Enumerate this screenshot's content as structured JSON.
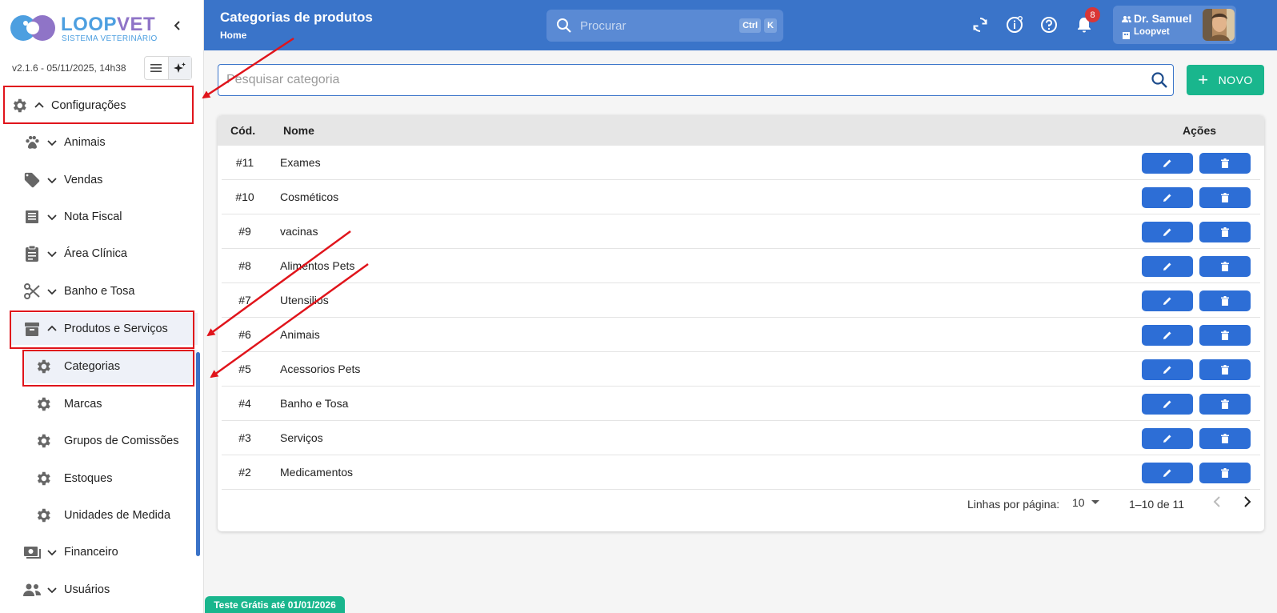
{
  "brand": {
    "name_part1": "LOOP",
    "name_part2": "VET",
    "subtitle": "SISTEMA VETERINÁRIO",
    "version": "v2.1.6 - 05/11/2025, 14h38"
  },
  "sidebar": {
    "items": [
      {
        "label": "Configurações",
        "icon": "gear-icon",
        "expanded": true
      },
      {
        "label": "Animais",
        "icon": "paw-icon"
      },
      {
        "label": "Vendas",
        "icon": "tag-icon"
      },
      {
        "label": "Nota Fiscal",
        "icon": "receipt-icon"
      },
      {
        "label": "Área Clínica",
        "icon": "clipboard-icon"
      },
      {
        "label": "Banho e Tosa",
        "icon": "scissors-icon"
      },
      {
        "label": "Produtos e Serviços",
        "icon": "archive-icon",
        "expanded": true
      },
      {
        "label": "Financeiro",
        "icon": "money-icon"
      },
      {
        "label": "Usuários",
        "icon": "users-icon"
      }
    ],
    "sub_items": [
      {
        "label": "Categorias",
        "icon": "gear-icon",
        "active": true
      },
      {
        "label": "Marcas",
        "icon": "gear-icon"
      },
      {
        "label": "Grupos de Comissões",
        "icon": "gear-icon"
      },
      {
        "label": "Estoques",
        "icon": "gear-icon"
      },
      {
        "label": "Unidades de Medida",
        "icon": "gear-icon"
      }
    ]
  },
  "header": {
    "title": "Categorias de produtos",
    "breadcrumb": "Home",
    "search_placeholder": "Procurar",
    "shortcut_key1": "Ctrl",
    "shortcut_key2": "K",
    "notification_count": "8",
    "user_name": "Dr. Samuel",
    "user_org": "Loopvet"
  },
  "main": {
    "search_placeholder": "Pesquisar categoria",
    "new_button": "NOVO",
    "table": {
      "columns": [
        "Cód.",
        "Nome",
        "Ações"
      ],
      "rows": [
        {
          "cod": "#11",
          "nome": "Exames"
        },
        {
          "cod": "#10",
          "nome": "Cosméticos"
        },
        {
          "cod": "#9",
          "nome": "vacinas"
        },
        {
          "cod": "#8",
          "nome": "Alimentos Pets"
        },
        {
          "cod": "#7",
          "nome": "Utensilios"
        },
        {
          "cod": "#6",
          "nome": "Animais"
        },
        {
          "cod": "#5",
          "nome": "Acessorios Pets"
        },
        {
          "cod": "#4",
          "nome": "Banho e Tosa"
        },
        {
          "cod": "#3",
          "nome": "Serviços"
        },
        {
          "cod": "#2",
          "nome": "Medicamentos"
        }
      ]
    },
    "pagination": {
      "rows_per_page_label": "Linhas por página:",
      "rows_per_page": "10",
      "range": "1–10 de 11"
    }
  },
  "trial_badge": "Teste Grátis até 01/01/2026",
  "colors": {
    "primary": "#3a74c9",
    "accent_green": "#19b68d",
    "action_blue": "#2d6ed6",
    "annotation_red": "#e0141b"
  }
}
